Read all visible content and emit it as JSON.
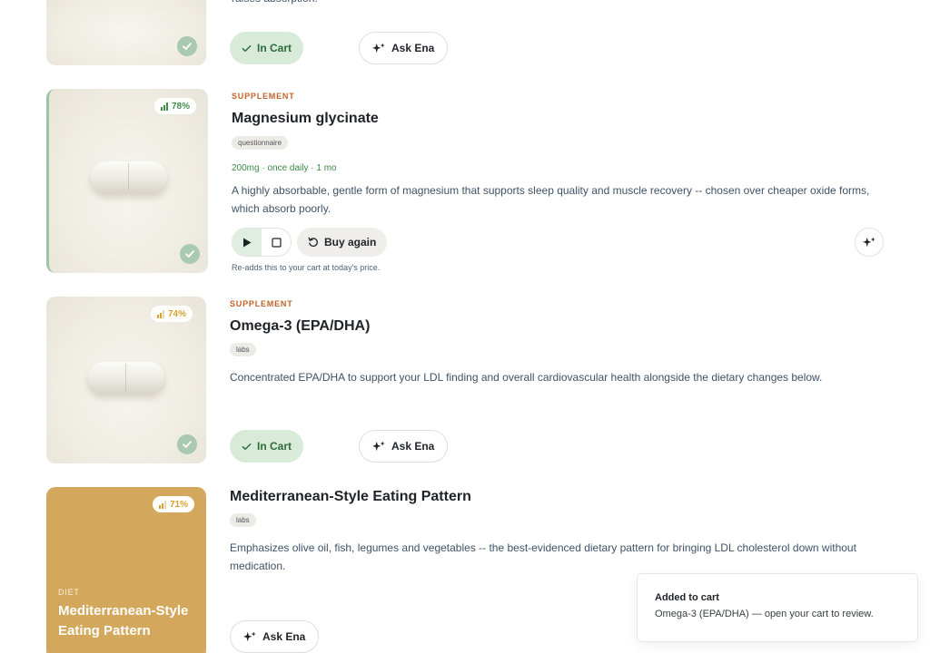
{
  "items": [
    {
      "description_tail": "raises absorption.",
      "in_cart_label": "In Cart",
      "ask_label": "Ask Ena"
    },
    {
      "category": "SUPPLEMENT",
      "score": "78%",
      "score_fraction": 0.78,
      "title": "Magnesium glycinate",
      "tag": "questionnaire",
      "dose": "200mg · once daily · 1 mo",
      "description": "A highly absorbable, gentle form of magnesium that supports sleep quality and muscle recovery -- chosen over cheaper oxide forms, which absorb poorly.",
      "buy_again_label": "Buy again",
      "buy_again_note": "Re-adds this to your cart at today's price."
    },
    {
      "category": "SUPPLEMENT",
      "score": "74%",
      "score_fraction": 0.74,
      "title": "Omega-3 (EPA/DHA)",
      "tag": "labs",
      "description": "Concentrated EPA/DHA to support your LDL finding and overall cardiovascular health alongside the dietary changes below.",
      "in_cart_label": "In Cart",
      "ask_label": "Ask Ena"
    },
    {
      "category": "DIET",
      "score": "71%",
      "score_fraction": 0.71,
      "title": "Mediterranean-Style Eating Pattern",
      "card_title": "Mediterranean-Style Eating Pattern",
      "tag": "labs",
      "description": "Emphasizes olive oil, fish, legumes and vegetables -- the best-evidenced dietary pattern for bringing LDL cholesterol down without medication.",
      "ask_label": "Ask Ena"
    }
  ],
  "toast": {
    "title": "Added to cart",
    "body": "Omega-3 (EPA/DHA) — open your cart to review."
  },
  "colors": {
    "category_accent": "#c0632d",
    "score_green": "#3f8f4a",
    "score_amber": "#d6a22b",
    "in_cart_bg": "#d8ebd9",
    "diet_card_bg": "#d4a85c"
  },
  "icons": [
    "check-icon",
    "sparkle-icon",
    "play-icon",
    "stop-icon",
    "refresh-icon",
    "signal-bars-icon"
  ]
}
